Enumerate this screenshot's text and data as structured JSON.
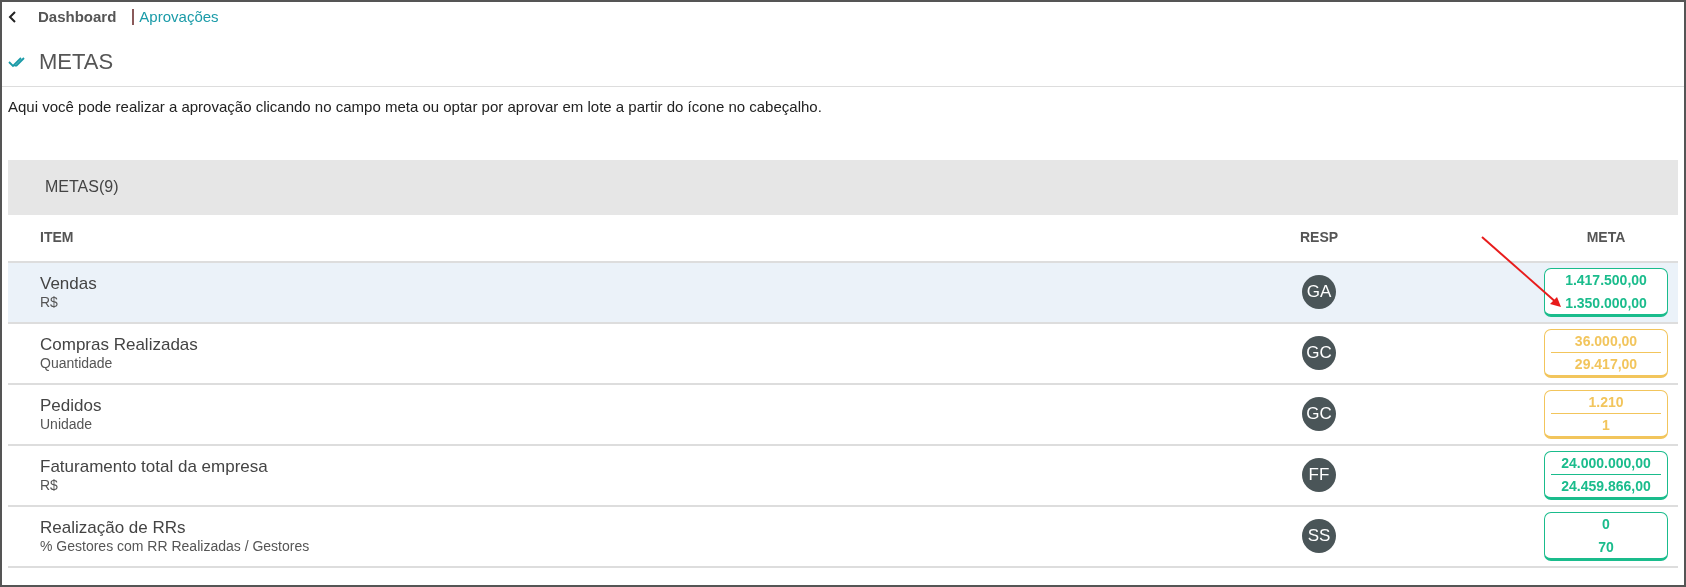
{
  "breadcrumb": {
    "back": "Dashboard",
    "current": "Aprovações"
  },
  "page_title": "METAS",
  "description": "Aqui você pode realizar a aprovação clicando no campo meta ou optar por aprovar em lote a partir do ícone no cabeçalho.",
  "section": {
    "title": "METAS(9)"
  },
  "table": {
    "columns": [
      "ITEM",
      "RESP",
      "META"
    ],
    "rows": [
      {
        "name": "Vendas",
        "unit": "R$",
        "resp": "GA",
        "target": "1.417.500,00",
        "actual": "1.350.000,00",
        "color": "#1abc8c",
        "divider": false,
        "selected": true
      },
      {
        "name": "Compras Realizadas",
        "unit": "Quantidade",
        "resp": "GC",
        "target": "36.000,00",
        "actual": "29.417,00",
        "color": "#f2c55c",
        "divider": true,
        "selected": false
      },
      {
        "name": "Pedidos",
        "unit": "Unidade",
        "resp": "GC",
        "target": "1.210",
        "actual": "1",
        "color": "#f2c55c",
        "divider": true,
        "selected": false
      },
      {
        "name": "Faturamento total da empresa",
        "unit": "R$",
        "resp": "FF",
        "target": "24.000.000,00",
        "actual": "24.459.866,00",
        "color": "#1abc8c",
        "divider": true,
        "selected": false
      },
      {
        "name": "Realização de RRs",
        "unit": "% Gestores com RR Realizadas / Gestores",
        "resp": "SS",
        "target": "0",
        "actual": "70",
        "color": "#1abc8c",
        "divider": false,
        "selected": false
      }
    ]
  }
}
